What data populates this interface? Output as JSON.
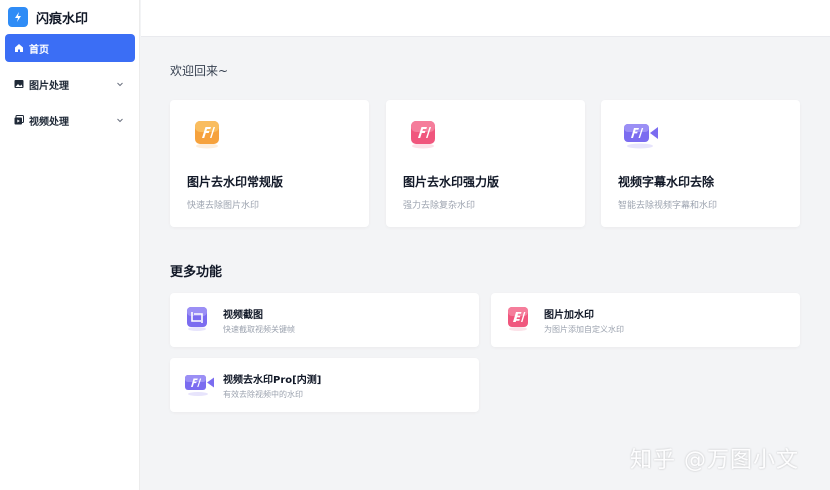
{
  "app": {
    "name": "闪痕水印"
  },
  "sidebar": {
    "items": [
      {
        "label": "首页",
        "icon": "home-icon"
      },
      {
        "label": "图片处理",
        "icon": "image-icon"
      },
      {
        "label": "视频处理",
        "icon": "video-icon"
      }
    ]
  },
  "main": {
    "welcome": "欢迎回来~",
    "feature_cards": [
      {
        "title": "图片去水印常规版",
        "desc": "快速去除图片水印",
        "icon": "image-fx-icon"
      },
      {
        "title": "图片去水印强力版",
        "desc": "强力去除复杂水印",
        "icon": "image-fx-icon"
      },
      {
        "title": "视频字幕水印去除",
        "desc": "智能去除视频字幕和水印",
        "icon": "video-fx-icon"
      }
    ],
    "more_title": "更多功能",
    "more_cards": [
      {
        "title": "视频截图",
        "desc": "快速截取视频关键帧",
        "icon": "screenshot-icon"
      },
      {
        "title": "图片加水印",
        "desc": "为图片添加自定义水印",
        "icon": "add-watermark-icon"
      },
      {
        "title": "视频去水印Pro[内测]",
        "desc": "有效去除视频中的水印",
        "icon": "video-fx-icon"
      }
    ]
  },
  "overlay": {
    "watermark": "知乎 @万图小文"
  },
  "colors": {
    "accent": "#3b6ef5",
    "brand": "#2f8cf6",
    "orange": "#f6a23d",
    "pink": "#f0567d",
    "purple": "#7b6cf0"
  }
}
